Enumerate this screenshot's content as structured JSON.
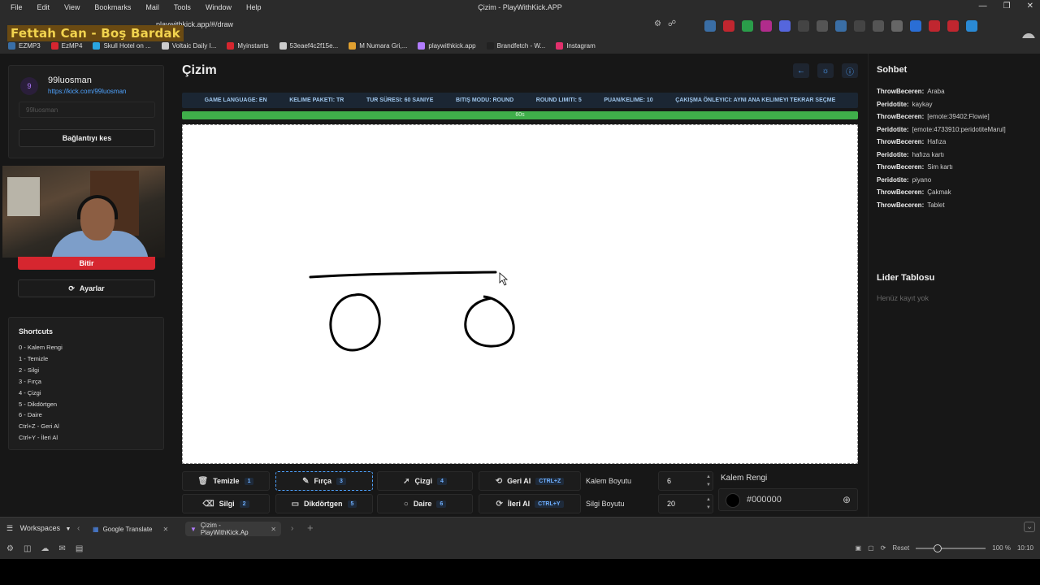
{
  "browser": {
    "menus": [
      "File",
      "Edit",
      "View",
      "Bookmarks",
      "Mail",
      "Tools",
      "Window",
      "Help"
    ],
    "window_title": "Çizim - PlayWithKick.APP",
    "url": "playwithkick.app/#/draw",
    "bookmarks": [
      {
        "label": "EZMP3",
        "color": "#3a6ea5"
      },
      {
        "label": "EzMP4",
        "color": "#d6262f"
      },
      {
        "label": "Skull Hotel on ...",
        "color": "#2aa5e0"
      },
      {
        "label": "Voltaic Daily I...",
        "color": "#cccccc"
      },
      {
        "label": "Myinstants",
        "color": "#d6262f"
      },
      {
        "label": "53eaef4c2f15e...",
        "color": "#cccccc"
      },
      {
        "label": "M Numara Gri,...",
        "color": "#e0a030"
      },
      {
        "label": "playwithkick.app",
        "color": "#b17cff"
      },
      {
        "label": "Brandfetch - W...",
        "color": "#222222"
      },
      {
        "label": "Instagram",
        "color": "#e1306c"
      }
    ],
    "tabs": {
      "workspaces": "Workspaces",
      "tab1": "Google Translate",
      "tab2": "Çizim - PlayWithKick.Ap"
    },
    "status": {
      "reset": "Reset",
      "zoom": "100 %",
      "time": "10:10"
    }
  },
  "overlay": {
    "streamer_name": "Fettah Can - Boş Bardak"
  },
  "sidebar": {
    "avatar_text": "9",
    "username": "99luosman",
    "link": "https://kick.com/99luosman",
    "input_placeholder": "99luosman",
    "disconnect": "Bağlantıyı kes",
    "end": "Bitir",
    "settings": "Ayarlar",
    "shortcuts_title": "Shortcuts",
    "shortcuts": [
      "0 - Kalem Rengi",
      "1 - Temizle",
      "2 - Silgi",
      "3 - Fırça",
      "4 - Çizgi",
      "5 - Dikdörtgen",
      "6 - Daire",
      "Ctrl+Z - Geri Al",
      "Ctrl+Y - İleri Al"
    ]
  },
  "main": {
    "title": "Çizim",
    "info": [
      "GAME LANGUAGE: EN",
      "KELIME PAKETI: TR",
      "TUR SÜRESI: 60 SANIYE",
      "BITIŞ MODU: ROUND",
      "ROUND LIMITI: 5",
      "PUAN/KELIME: 10",
      "ÇAKIŞMA ÖNLEYICI: AYNI ANA KELIMEYI TEKRAR SEÇME"
    ],
    "timer_label": "60s",
    "timer_fraction": 1.0
  },
  "tools": {
    "temizle": {
      "label": "Temizle",
      "key": "1"
    },
    "firca": {
      "label": "Fırça",
      "key": "3"
    },
    "cizgi": {
      "label": "Çizgi",
      "key": "4"
    },
    "geri": {
      "label": "Geri Al",
      "key": "CTRL+Z"
    },
    "silgi": {
      "label": "Silgi",
      "key": "2"
    },
    "dikdortgen": {
      "label": "Dikdörtgen",
      "key": "5"
    },
    "daire": {
      "label": "Daire",
      "key": "6"
    },
    "ileri": {
      "label": "İleri Al",
      "key": "CTRL+Y"
    },
    "pen_size_label": "Kalem Boyutu",
    "pen_size": "6",
    "eraser_size_label": "Silgi Boyutu",
    "eraser_size": "20",
    "color_title": "Kalem Rengi",
    "color_value": "#000000"
  },
  "chat": {
    "title": "Sohbet",
    "messages": [
      {
        "user": "ThrowBeceren:",
        "text": "Araba"
      },
      {
        "user": "Peridotite:",
        "text": "kaykay"
      },
      {
        "user": "ThrowBeceren:",
        "text": "[emote:39402:Flowie]"
      },
      {
        "user": "Peridotite:",
        "text": "[emote:4733910:peridotiteMarul]"
      },
      {
        "user": "ThrowBeceren:",
        "text": "Hafıza"
      },
      {
        "user": "Peridotite:",
        "text": "hafıza kartı"
      },
      {
        "user": "ThrowBeceren:",
        "text": "Sim kartı"
      },
      {
        "user": "Peridotite:",
        "text": "piyano"
      },
      {
        "user": "ThrowBeceren:",
        "text": "Çakmak"
      },
      {
        "user": "ThrowBeceren:",
        "text": "Tablet"
      }
    ]
  },
  "leaderboard": {
    "title": "Lider Tablosu",
    "empty": "Henüz kayıt yok"
  }
}
